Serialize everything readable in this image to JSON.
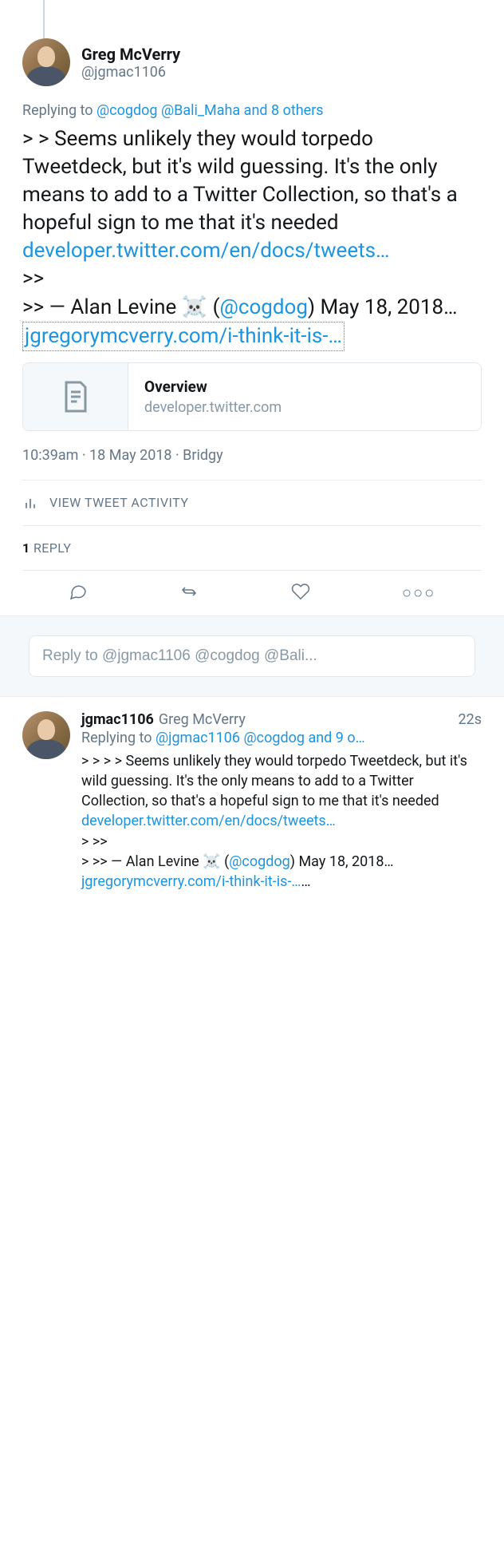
{
  "main": {
    "author_name": "Greg McVerry",
    "author_handle": "@jgmac1106",
    "reply_prefix": "Replying to ",
    "reply_mention1": "@cogdog",
    "reply_mention2": "@Bali_Maha",
    "reply_others": " and 8 others",
    "body_line1": "> > Seems unlikely they would torpedo Tweetdeck, but it's wild guessing. It's the only means to add to a Twitter Collection, so that's a hopeful sign to me that it's needed ",
    "body_link1": "developer.twitter.com/en/docs/tweets…",
    "body_line2": ">>",
    "body_line3a": ">> — Alan Levine ",
    "body_skull": "☠️",
    "body_line3b": " (",
    "body_mention": "@cogdog",
    "body_line3c": ") May 18, 2018… ",
    "body_link2": "jgregorymcverry.com/i-think-it-is-…",
    "card_title": "Overview",
    "card_domain": "developer.twitter.com",
    "timestamp": "10:39am · 18 May 2018 · Bridgy",
    "activity_label": "VIEW TWEET ACTIVITY",
    "reply_count": "1",
    "reply_label": " REPLY"
  },
  "compose": {
    "placeholder": "Reply to @jgmac1106 @cogdog @Bali..."
  },
  "reply": {
    "username": "jgmac1106",
    "displayname": "Greg McVerry",
    "time": "22s",
    "reply_prefix": "Replying to ",
    "reply_mention1": "@jgmac1106",
    "reply_mention2": "@cogdog",
    "reply_others": " and 9 o…",
    "body_line1": "> > > > Seems unlikely they would torpedo Tweetdeck, but it's wild guessing. It's the only means to add to a Twitter Collection, so that's a hopeful sign to me that it's needed ",
    "body_link1": "developer.twitter.com/en/docs/tweets…",
    "body_line2": "> >>",
    "body_line3a": "> >> — Alan Levine ",
    "body_skull": "☠️",
    "body_line3b": " (",
    "body_mention": "@cogdog",
    "body_line3c": ") May 18, 2018… ",
    "body_link2": "jgregorymcverry.com/i-think-it-is-…",
    "trailing": "…"
  }
}
